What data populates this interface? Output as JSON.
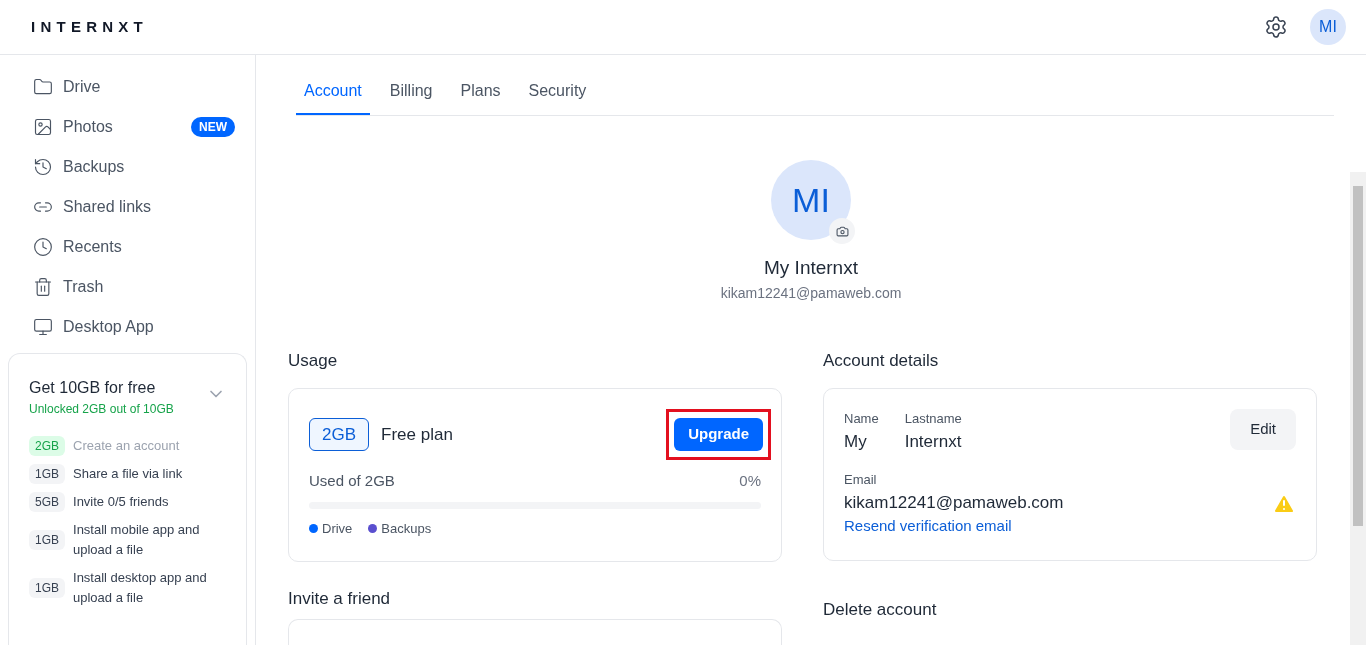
{
  "header": {
    "logo": "INTERNXT",
    "avatar": "MI"
  },
  "sidebar": {
    "items": [
      {
        "kind": "folder",
        "label": "Drive"
      },
      {
        "kind": "image",
        "label": "Photos",
        "badge": "NEW"
      },
      {
        "kind": "history",
        "label": "Backups"
      },
      {
        "kind": "link",
        "label": "Shared links"
      },
      {
        "kind": "clock",
        "label": "Recents"
      },
      {
        "kind": "trash",
        "label": "Trash"
      },
      {
        "kind": "monitor",
        "label": "Desktop App"
      }
    ],
    "promo": {
      "title": "Get 10GB for free",
      "subtitle": "Unlocked 2GB out of 10GB",
      "expanded": false,
      "tasks": [
        {
          "amount": "2GB",
          "label": "Create an account",
          "done": true
        },
        {
          "amount": "1GB",
          "label": "Share a file via link",
          "done": false
        },
        {
          "amount": "5GB",
          "label": "Invite 0/5 friends",
          "done": false
        },
        {
          "amount": "1GB",
          "label": "Install mobile app and upload a file",
          "done": false
        },
        {
          "amount": "1GB",
          "label": "Install desktop app and upload a file",
          "done": false
        }
      ]
    }
  },
  "tabs": [
    {
      "label": "Account",
      "selected": true
    },
    {
      "label": "Billing",
      "selected": false
    },
    {
      "label": "Plans",
      "selected": false
    },
    {
      "label": "Security",
      "selected": false
    }
  ],
  "profile": {
    "initials": "MI",
    "name": "My Internxt",
    "email": "kikam12241@pamaweb.com"
  },
  "usage": {
    "heading": "Usage",
    "plan_size": "2GB",
    "plan_name": "Free plan",
    "upgrade": "Upgrade",
    "used_label": "Used of 2GB",
    "percent": "0%",
    "level": 0,
    "legend": [
      {
        "label": "Drive",
        "color": "#0066ff"
      },
      {
        "label": "Backups",
        "color": "#5a4fcf"
      }
    ]
  },
  "invite": {
    "heading": "Invite a friend"
  },
  "account_details": {
    "heading": "Account details",
    "name_label": "Name",
    "name": "My",
    "lastname_label": "Lastname",
    "lastname": "Internxt",
    "edit": "Edit",
    "email_label": "Email",
    "email": "kikam12241@pamaweb.com",
    "resend": "Resend verification email",
    "warning": true
  },
  "delete_account": {
    "heading": "Delete account"
  }
}
